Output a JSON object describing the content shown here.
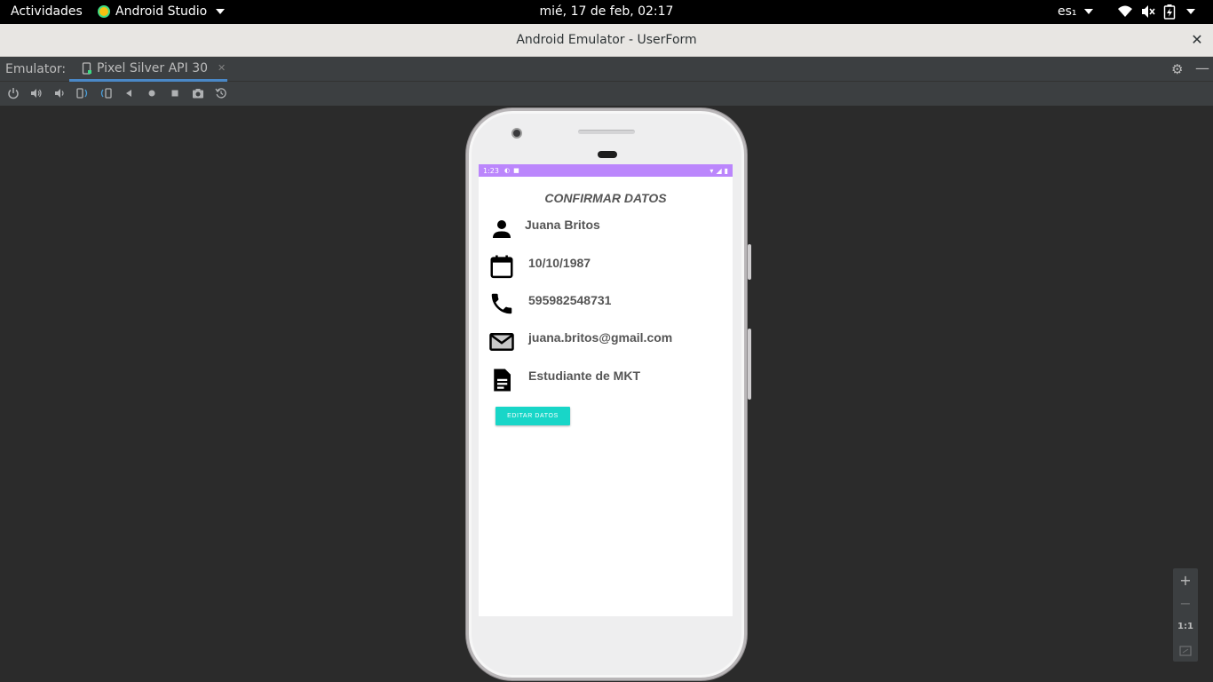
{
  "topbar": {
    "activities": "Actividades",
    "app_name": "Android Studio",
    "clock": "mié, 17 de feb, 02:17",
    "lang": "es₁"
  },
  "window": {
    "title": "Android Emulator - UserForm"
  },
  "emulator": {
    "label": "Emulator:",
    "device_tab": "Pixel Silver API 30"
  },
  "toolbar": {
    "buttons": [
      "power-icon",
      "volume-up-icon",
      "volume-down-icon",
      "rotate-left-icon",
      "rotate-right-icon",
      "back-icon",
      "home-icon",
      "overview-icon",
      "screenshot-icon",
      "snapshot-icon"
    ]
  },
  "device": {
    "status_time": "1:23"
  },
  "app": {
    "title": "CONFIRMAR DATOS",
    "name": "Juana Britos",
    "birthdate": "10/10/1987",
    "phone": "595982548731",
    "email": "juana.britos@gmail.com",
    "description": "Estudiante de MKT",
    "edit_button": "EDITAR DATOS"
  },
  "zoom": {
    "plus": "+",
    "minus": "−",
    "ratio": "1:1"
  },
  "colors": {
    "status_bar": "#bb86fc",
    "button": "#18d6c8",
    "text": "#555555"
  }
}
